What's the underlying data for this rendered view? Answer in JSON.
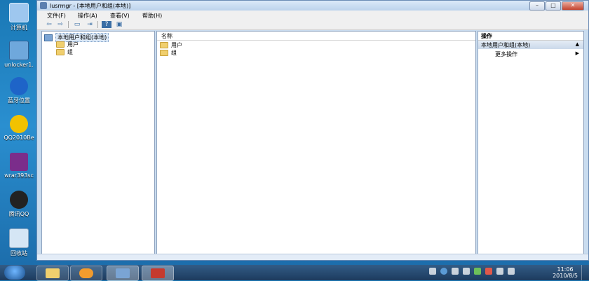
{
  "desktop": {
    "icons": [
      {
        "label": "计算机",
        "icon": "computer-icon",
        "color": "#9ec7ef"
      },
      {
        "label": "unlocker1.",
        "icon": "unlocker-icon",
        "color": "#6fa8dc"
      },
      {
        "label": "蓝牙位置",
        "icon": "bluetooth-icon",
        "color": "#1e64c8"
      },
      {
        "label": "QQ2010Be",
        "icon": "qq-icon",
        "color": "#f2c200"
      },
      {
        "label": "wrar393sc",
        "icon": "winrar-icon",
        "color": "#7b2d8b"
      },
      {
        "label": "腾讯QQ",
        "icon": "qq-icon",
        "color": "#222222"
      },
      {
        "label": "回收站",
        "icon": "recycle-bin-icon",
        "color": "#d5e6f5"
      }
    ]
  },
  "window": {
    "title": "lusrmgr - [本地用户和组(本地)]",
    "controls": {
      "minimize": "–",
      "maximize": "□",
      "close": "✕"
    },
    "menu": [
      "文件(F)",
      "操作(A)",
      "查看(V)",
      "帮助(H)"
    ],
    "toolbar": {
      "back": "⇦",
      "forward": "⇨",
      "console": "▭",
      "export": "⇥",
      "help": "?",
      "properties": "▣"
    },
    "tree": {
      "root": "本地用户和组(本地)",
      "children": [
        "用户",
        "组"
      ]
    },
    "list": {
      "column": "名称",
      "rows": [
        "用户",
        "组"
      ]
    },
    "actions": {
      "header": "操作",
      "section": "本地用户和组(本地)",
      "section_caret": "▲",
      "item": "更多操作",
      "item_arrow": "▶"
    }
  },
  "taskbar": {
    "clock_time": "11:06",
    "clock_date": "2010/8/5",
    "tray_icons": [
      "keyboard-icon",
      "language-icon",
      "help-icon",
      "input-method-icon",
      "network-icon",
      "action-center-icon",
      "security-icon",
      "volume-icon"
    ]
  }
}
